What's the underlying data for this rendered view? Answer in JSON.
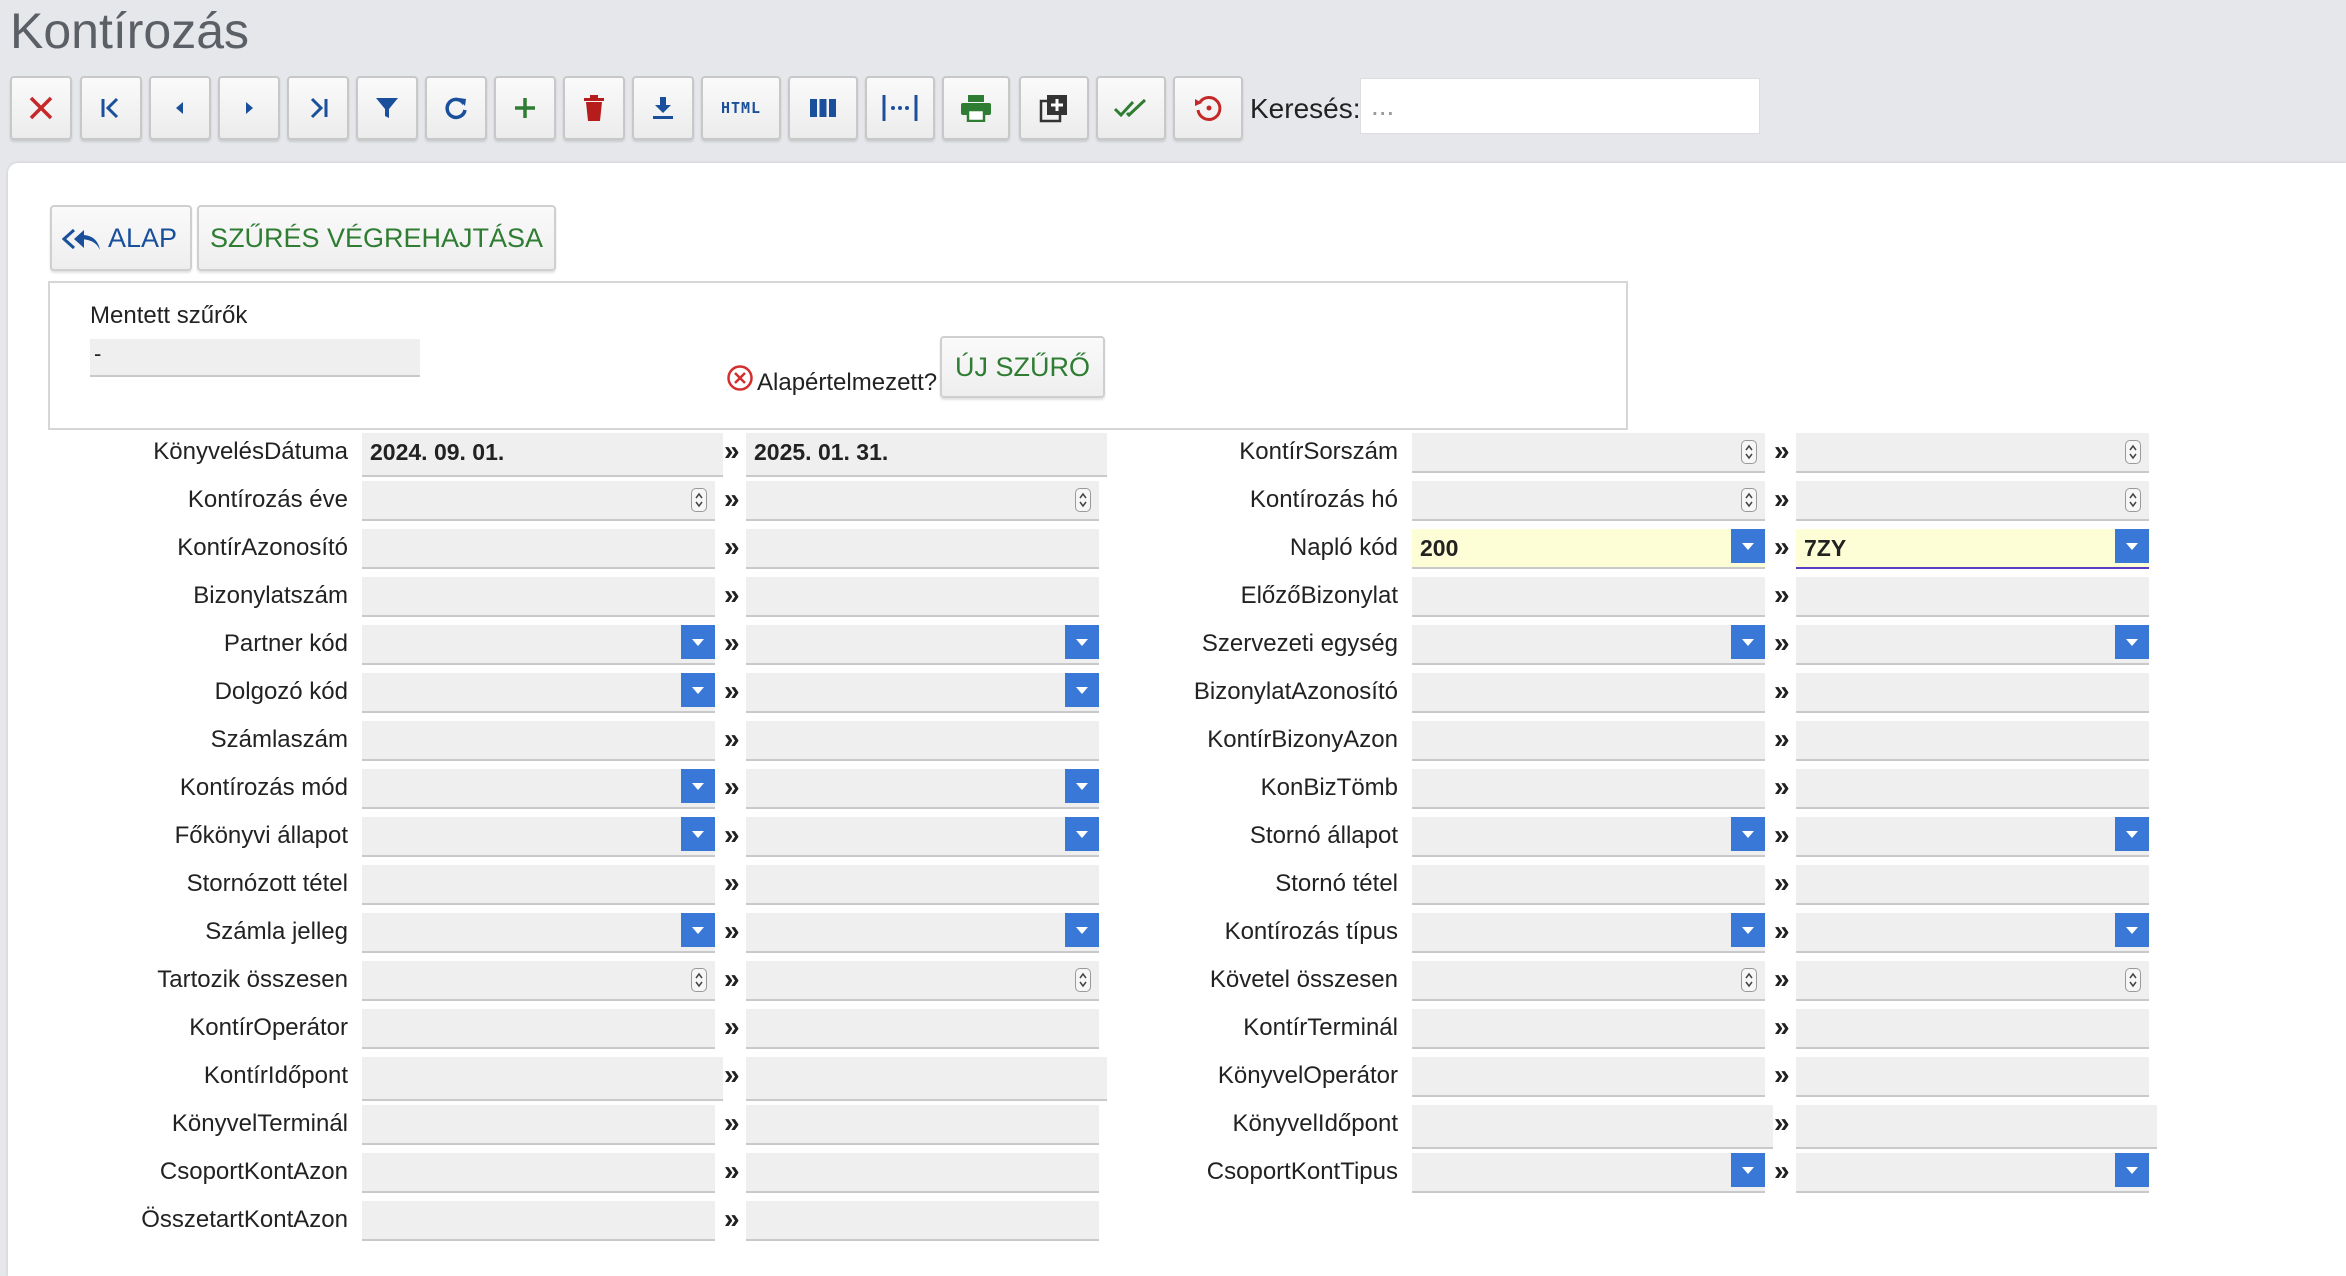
{
  "window": {
    "title": "Kontírozás"
  },
  "toolbar": {
    "html_label": "HTML",
    "search_label": "Keresés:",
    "search_placeholder": "...",
    "search_value": ""
  },
  "actions": {
    "alap_label": "ALAP",
    "execute_label": "SZŰRÉS VÉGREHAJTÁSA"
  },
  "saved_filters": {
    "label": "Mentett szűrők",
    "selected": "-",
    "default_label": "Alapértelmezett?",
    "new_filter_label": "ÚJ SZŰRŐ"
  },
  "separator": "»",
  "left_fields": [
    {
      "label": "KönyvelésDátuma",
      "type": "date",
      "from": "2024. 09. 01.",
      "to": "2025. 01. 31."
    },
    {
      "label": "Kontírozás éve",
      "type": "number",
      "from": "",
      "to": ""
    },
    {
      "label": "KontírAzonosító",
      "type": "text",
      "from": "",
      "to": ""
    },
    {
      "label": "Bizonylatszám",
      "type": "text",
      "from": "",
      "to": ""
    },
    {
      "label": "Partner kód",
      "type": "select",
      "from": "",
      "to": ""
    },
    {
      "label": "Dolgozó kód",
      "type": "select",
      "from": "",
      "to": ""
    },
    {
      "label": "Számlaszám",
      "type": "text",
      "from": "",
      "to": ""
    },
    {
      "label": "Kontírozás mód",
      "type": "select",
      "from": "",
      "to": ""
    },
    {
      "label": "Főkönyvi állapot",
      "type": "select",
      "from": "",
      "to": ""
    },
    {
      "label": "Stornózott tétel",
      "type": "text",
      "from": "",
      "to": ""
    },
    {
      "label": "Számla jelleg",
      "type": "select",
      "from": "",
      "to": ""
    },
    {
      "label": "Tartozik összesen",
      "type": "number",
      "from": "",
      "to": ""
    },
    {
      "label": "KontírOperátor",
      "type": "text",
      "from": "",
      "to": ""
    },
    {
      "label": "KontírIdőpont",
      "type": "date",
      "from": "",
      "to": ""
    },
    {
      "label": "KönyvelTerminál",
      "type": "text",
      "from": "",
      "to": ""
    },
    {
      "label": "CsoportKontAzon",
      "type": "text",
      "from": "",
      "to": ""
    },
    {
      "label": "ÖsszetartKontAzon",
      "type": "text",
      "from": "",
      "to": ""
    }
  ],
  "right_fields": [
    {
      "label": "KontírSorszám",
      "type": "number",
      "from": "",
      "to": ""
    },
    {
      "label": "Kontírozás hó",
      "type": "number",
      "from": "",
      "to": ""
    },
    {
      "label": "Napló kód",
      "type": "select",
      "from": "200",
      "to": "7ZY",
      "highlight": true
    },
    {
      "label": "ElőzőBizonylat",
      "type": "text",
      "from": "",
      "to": ""
    },
    {
      "label": "Szervezeti egység",
      "type": "select",
      "from": "",
      "to": ""
    },
    {
      "label": "BizonylatAzonosító",
      "type": "text",
      "from": "",
      "to": ""
    },
    {
      "label": "KontírBizonyAzon",
      "type": "text",
      "from": "",
      "to": ""
    },
    {
      "label": "KonBizTömb",
      "type": "text",
      "from": "",
      "to": ""
    },
    {
      "label": "Stornó állapot",
      "type": "select",
      "from": "",
      "to": ""
    },
    {
      "label": "Stornó tétel",
      "type": "text",
      "from": "",
      "to": ""
    },
    {
      "label": "Kontírozás típus",
      "type": "select",
      "from": "",
      "to": ""
    },
    {
      "label": "Követel összesen",
      "type": "number",
      "from": "",
      "to": ""
    },
    {
      "label": "KontírTerminál",
      "type": "text",
      "from": "",
      "to": ""
    },
    {
      "label": "KönyvelOperátor",
      "type": "text",
      "from": "",
      "to": ""
    },
    {
      "label": "KönyvelIdőpont",
      "type": "date",
      "from": "",
      "to": ""
    },
    {
      "label": "CsoportKontTipus",
      "type": "select",
      "from": "",
      "to": ""
    }
  ],
  "colors": {
    "accent_blue": "#3a78d8",
    "action_green": "#2e7d32",
    "danger_red": "#c62828"
  }
}
